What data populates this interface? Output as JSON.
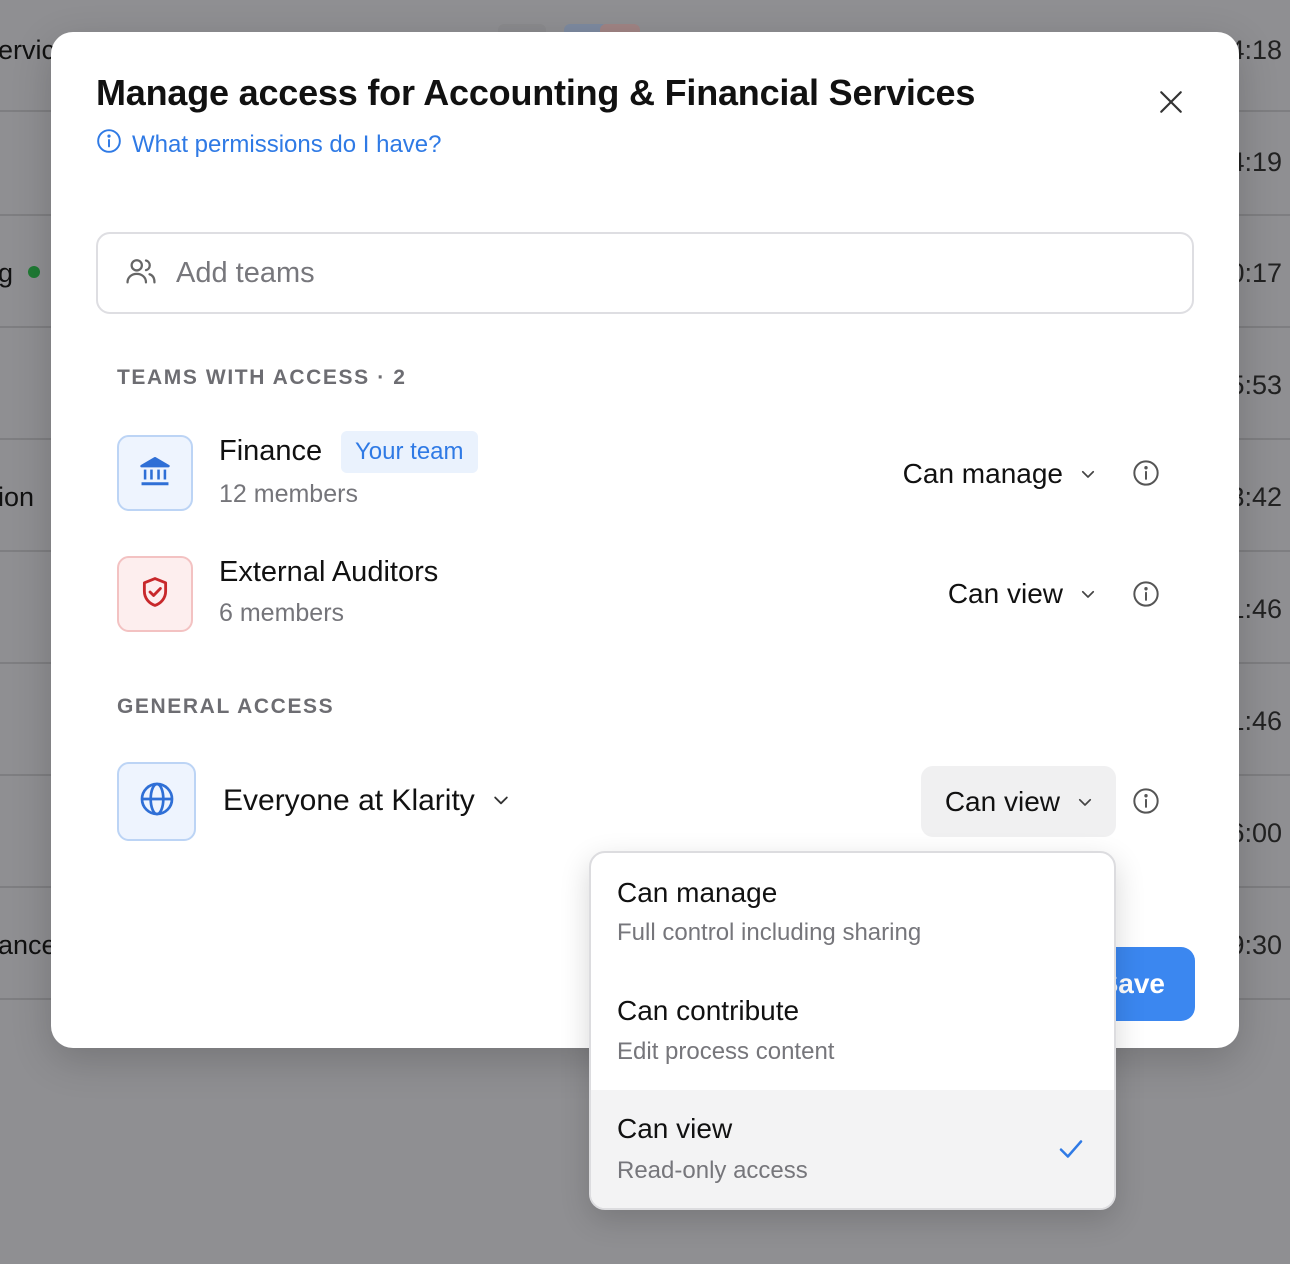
{
  "background": {
    "rows": [
      {
        "left": "ervic",
        "right": "4:18"
      },
      {
        "left": "",
        "right": "4:19"
      },
      {
        "left": "g",
        "right": "0:17",
        "status_dot": true
      },
      {
        "left": "",
        "right": "5:53"
      },
      {
        "left": "ion",
        "right": "3:42"
      },
      {
        "left": "",
        "right": "1:46"
      },
      {
        "left": "",
        "right": "1:46"
      },
      {
        "left": "",
        "right": "6:00"
      },
      {
        "left": "ance",
        "right": "9:30"
      }
    ]
  },
  "modal": {
    "title": "Manage access for Accounting & Financial Services",
    "help_link": "What permissions do I have?",
    "search_placeholder": "Add teams",
    "teams_section_label": "TEAMS WITH ACCESS · 2",
    "teams": [
      {
        "name": "Finance",
        "badge": "Your team",
        "members": "12 members",
        "permission": "Can manage",
        "icon": "bank-icon"
      },
      {
        "name": "External Auditors",
        "members": "6 members",
        "permission": "Can view",
        "icon": "shield-check-icon"
      }
    ],
    "general_section_label": "GENERAL ACCESS",
    "general": {
      "scope": "Everyone at Klarity",
      "permission": "Can view",
      "icon": "globe-icon"
    },
    "save_label": "Save"
  },
  "menu": {
    "items": [
      {
        "title": "Can manage",
        "desc": "Full control including sharing",
        "selected": false
      },
      {
        "title": "Can contribute",
        "desc": "Edit process content",
        "selected": false
      },
      {
        "title": "Can view",
        "desc": "Read-only access",
        "selected": true
      }
    ]
  },
  "colors": {
    "accent": "#2f7ae5",
    "save_button": "#3b87f0",
    "finance_icon": "#2f6fd6",
    "auditors_icon": "#c8282b",
    "overlay": "#8f8f92"
  }
}
